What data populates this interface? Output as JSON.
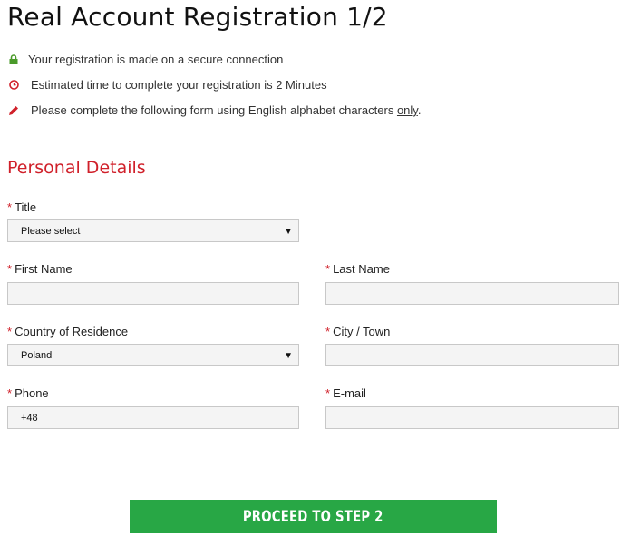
{
  "page": {
    "title": "Real Account Registration 1/2"
  },
  "info": [
    {
      "icon": "lock-icon",
      "text": "Your registration is made on a secure connection",
      "color": "#4a9a2a"
    },
    {
      "icon": "clock-icon",
      "text": "Estimated time to complete your registration is 2 Minutes",
      "color": "#d0202a"
    },
    {
      "icon": "pencil-icon",
      "text_before": "Please complete the following form using English alphabet characters ",
      "text_underlined": "only",
      "text_after": ".",
      "color": "#d0202a"
    }
  ],
  "section": {
    "title": "Personal Details"
  },
  "form": {
    "required_marker": "*",
    "title": {
      "label": "Title",
      "value": "Please select"
    },
    "first_name": {
      "label": "First Name",
      "value": ""
    },
    "last_name": {
      "label": "Last Name",
      "value": ""
    },
    "country": {
      "label": "Country of Residence",
      "value": "Poland"
    },
    "city": {
      "label": "City / Town",
      "value": ""
    },
    "phone": {
      "label": "Phone",
      "value": "+48"
    },
    "email": {
      "label": "E-mail",
      "value": ""
    },
    "select_arrow": "▼"
  },
  "actions": {
    "proceed_label": "PROCEED TO STEP 2"
  },
  "colors": {
    "accent_red": "#d0202a",
    "button_green": "#28a745",
    "field_bg": "#f4f4f4"
  }
}
